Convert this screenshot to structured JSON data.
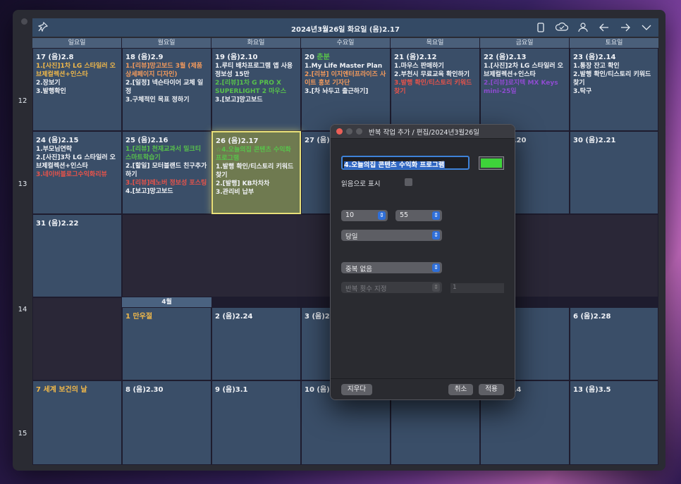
{
  "window": {
    "title": "2024년3월26일 화요일 (음)2.17",
    "toolbar_icons": [
      "phone-icon",
      "cloud-check-icon",
      "person-icon",
      "arrow-left-icon",
      "arrow-right-icon",
      "chevron-down-icon"
    ]
  },
  "weekdays": [
    "일요일",
    "월요일",
    "화요일",
    "수요일",
    "목요일",
    "금요일",
    "토요일"
  ],
  "weeks": [
    "12",
    "13",
    "14",
    "15"
  ],
  "cells": {
    "w12": [
      {
        "date": "17 (음)2.8",
        "events": [
          {
            "t": "1.[사진]1차 LG 스타일러 오브제컬렉션+인스타",
            "c": "y"
          },
          {
            "t": "2.장보기",
            "c": ""
          },
          {
            "t": "3.발행확인",
            "c": ""
          }
        ]
      },
      {
        "date": "18 (음)2.9",
        "events": [
          {
            "t": "1.[리뷰]망고보드 3월 (제품상세페이지 디자인)",
            "c": "o"
          },
          {
            "t": "2.[일정] 넥슨타이어 교체 일정",
            "c": ""
          },
          {
            "t": "3.구체적인 목표 정하기",
            "c": ""
          }
        ]
      },
      {
        "date": "19 (음)2.10",
        "events": [
          {
            "t": "1.루티 배차프로그램 앱 사용 정보성 15만",
            "c": ""
          },
          {
            "t": "2.[리뷰]1차 G PRO X SUPERLIGHT 2 마우스",
            "c": "g"
          },
          {
            "t": "3.[보고]망고보드",
            "c": ""
          }
        ]
      },
      {
        "date": "20 춘분",
        "events": [
          {
            "t": "1.My Life Master Plan",
            "c": ""
          },
          {
            "t": "2.[리뷰] 이지엔터프라이즈 사이트 홍보 기자단",
            "c": "o"
          },
          {
            "t": "3.[차 놔두고 출근하기]",
            "c": ""
          }
        ]
      },
      {
        "date": "21 (음)2.12",
        "events": [
          {
            "t": "1.마우스 판매하기",
            "c": ""
          },
          {
            "t": "2.부천시 무료교육 확인하기",
            "c": ""
          },
          {
            "t": "3.발행 확인/티스토리 키워드 찾기",
            "c": "r"
          }
        ]
      },
      {
        "date": "22 (음)2.13",
        "events": [
          {
            "t": "1.[사진]2차 LG 스타일러 오브제컬렉션+인스타",
            "c": ""
          },
          {
            "t": "2.[리뷰]로지텍 MX Keys mini-25일",
            "c": "p"
          }
        ]
      },
      {
        "date": "23 (음)2.14",
        "events": [
          {
            "t": "1.통장 잔고 확인",
            "c": ""
          },
          {
            "t": "2.발행 확인/티스토리 키워드 찾기",
            "c": ""
          },
          {
            "t": "3.탁구",
            "c": ""
          }
        ]
      }
    ],
    "w13": [
      {
        "date": "24 (음)2.15",
        "events": [
          {
            "t": "1.부모님연락",
            "c": ""
          },
          {
            "t": "2.[사진]3차 LG 스타일러 오브제컬렉션+인스타",
            "c": ""
          },
          {
            "t": "3.네이버블로그수익화리뷰",
            "c": "r"
          }
        ]
      },
      {
        "date": "25 (음)2.16",
        "events": [
          {
            "t": "1.[리뷰] 천재교과서 밀크티 스마트학습기",
            "c": "g"
          },
          {
            "t": "2.[할일] 모터블랜드 친구추가하기",
            "c": ""
          },
          {
            "t": "3.[리뷰]레노버 정보성 포스팅",
            "c": "r"
          },
          {
            "t": "4.[보고]망고보드",
            "c": ""
          }
        ]
      },
      {
        "date": "26 (음)2.17",
        "events": [
          {
            "t": "☆4.오늘의집 콘텐츠 수익화 프로그램",
            "c": "g"
          },
          {
            "t": "1.발행 확인/티스토리 키워드 찾기",
            "c": ""
          },
          {
            "t": "2.[발행] KB차차차",
            "c": ""
          },
          {
            "t": "3.관리비 납부",
            "c": ""
          }
        ]
      },
      {
        "date": "27 (음)2.18",
        "events": []
      },
      {
        "date": "",
        "events": []
      },
      {
        "date": "29 (음)2.20",
        "events": []
      },
      {
        "date": "30 (음)2.21",
        "events": []
      }
    ],
    "w14": [
      {
        "date": "31 (음)2.22",
        "events": []
      },
      {
        "date": "1 만우절",
        "events": []
      },
      {
        "date": "2 (음)2.24",
        "events": []
      },
      {
        "date": "3 (음)2.25",
        "events": []
      },
      {
        "date": "",
        "events": []
      },
      {
        "date": "",
        "events": []
      },
      {
        "date": "6 (음)2.28",
        "events": []
      }
    ],
    "w15": [
      {
        "date": "7 세계 보건의 날",
        "events": []
      },
      {
        "date": "8 (음)2.30",
        "events": []
      },
      {
        "date": "9 (음)3.1",
        "events": []
      },
      {
        "date": "10 (음)3.2",
        "events": []
      },
      {
        "date": "",
        "events": []
      },
      {
        "date": "12 (음)3.4",
        "events": []
      },
      {
        "date": "13 (음)3.5",
        "events": []
      }
    ],
    "month_label": "4월"
  },
  "dialog": {
    "title": "반복 작업 추가 / 편집/2024년3월26일",
    "task_text": "4.오늘의집 콘텐츠 수익화 프로그램",
    "color": "#3ed43a",
    "read_label": "읽음으로 표시",
    "hour": "10",
    "minute": "55",
    "period": "당일",
    "repeat": "중복 없음",
    "repeat_count_label": "반복 횟수 지정",
    "repeat_count": "1",
    "delete_label": "지우다",
    "cancel_label": "취소",
    "apply_label": "적용"
  }
}
